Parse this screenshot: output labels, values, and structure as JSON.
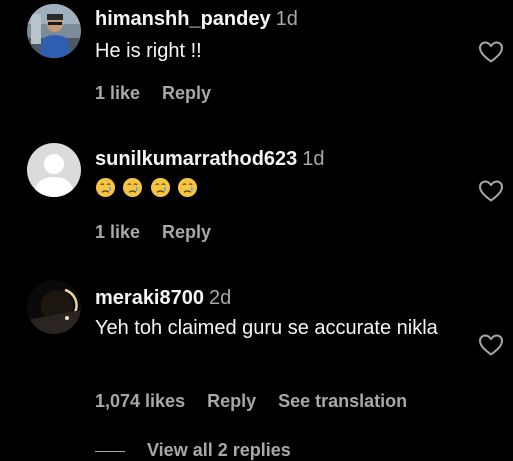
{
  "comments": [
    {
      "username": "himanshh_pandey",
      "time": "1d",
      "text": "He is right !!",
      "likes": "1 like",
      "reply": "Reply"
    },
    {
      "username": "sunilkumarrathod623",
      "time": "1d",
      "emoji": "crying-face-emoji",
      "emoji_count": 4,
      "likes": "1 like",
      "reply": "Reply"
    },
    {
      "username": "meraki8700",
      "time": "2d",
      "text": "Yeh toh claimed guru se accurate nikla",
      "likes": "1,074 likes",
      "reply": "Reply",
      "translate": "See translation"
    }
  ],
  "view_replies": "View all 2 replies",
  "colors": {
    "background": "#000000",
    "primary_text": "#f5f5f5",
    "secondary_text": "#a8a8a8"
  }
}
